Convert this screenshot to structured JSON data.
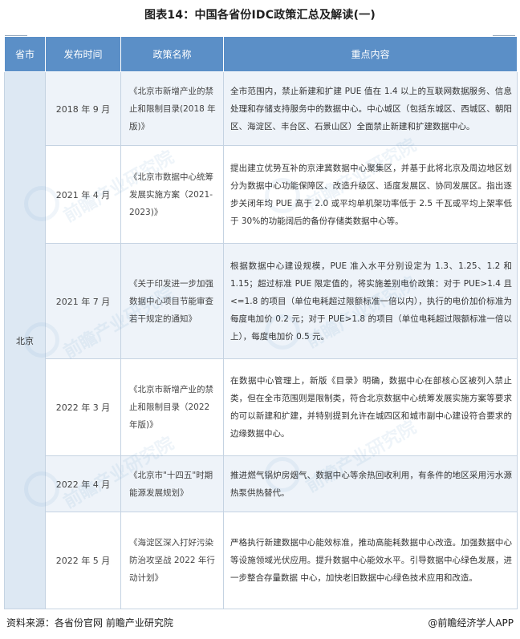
{
  "title": "图表14：中国各省份IDC政策汇总及解读(一)",
  "table": {
    "headers": [
      "省市",
      "发布时间",
      "政策名称",
      "重点内容"
    ],
    "province": "北京",
    "rows": [
      {
        "date": "2018 年 9 月",
        "name": "《北京市新增产业的禁止和限制目录(2018 年版)》",
        "content": "全市范围内，禁止新建和扩建 PUE 值在 1.4 以上的互联网数据服务、信息处理和存储支持服务中的数据中心。中心城区（包括东城区、西城区、朝阳区、海淀区、丰台区、石景山区）全面禁止新建和扩建数据中心。"
      },
      {
        "date": "2021 年 4 月",
        "name": "《北京市数据中心统筹发展实施方案（2021-2023)》",
        "content": "提出建立优势互补的京津冀数据中心聚集区，并基于此将北京及周边地区划分为数据中心功能保障区、改造升级区、适度发展区、协同发展区。指出逐步关闭年均 PUE 高于 2.0 或平均单机架功率低于 2.5 千瓦或平均上架率低于 30%的功能阔后的备份存储类数据中心等。"
      },
      {
        "date": "2021 年 7 月",
        "name": "《关于印发进一步加强数据中心项目节能审查若干规定的通知》",
        "content": "根据数据中心建设规模，PUE 准入水平分别设定为 1.3、1.25、1.2 和 1.15；超过标准 PUE 限定值的，将实施差别电价政策：对于 PUE>1.4 且<=1.8 的项目（单位电耗超过限额标准一倍以内），执行的电价加价标准为每度电加价 0.2 元；对于 PUE>1.8 的项目（单位电耗超过限额标准一倍以上），每度电加价 0.5 元。"
      },
      {
        "date": "2022 年 3 月",
        "name": "《北京市新增产业的禁止和限制目录（2022 年版)》",
        "content": "在数据中心管理上，新版《目录》明确，数据中心在部核心区被列入禁止类，但在全市范围则是限制类，符合北京数据中心统筹发展实施方案等要求的可以新建和扩建，并特别提到允许在城四区和城市副中心建设符合要求的边缘数据中心。"
      },
      {
        "date": "2022 年 4 月",
        "name": "《北京市\"十四五\"时期能源发展规划》",
        "content": "推进燃气锅炉房烟气、数据中心等余热回收利用，有条件的地区采用污水源热泵供热替代。"
      },
      {
        "date": "2022 年 5 月",
        "name": "《海淀区深入打好污染防治攻坚战 2022 年行动计划》",
        "content": "严格执行新建数据中心能效标准，推动高能耗数据中心改造。加强数据中心等设施领域光伏应用。提升数据中心能效水平。引导数据中心绿色发展，进一步整合存量数据 中心，加快老旧数据中心绿色技术应用和改造。"
      }
    ]
  },
  "watermark": "前瞻产业研究院",
  "footer": {
    "source": "资料来源：各省份官网 前瞻产业研究院",
    "brand": "@前瞻经济学人APP"
  },
  "colors": {
    "header_bg": "#5b8fc7",
    "province_bg": "#dde8f3",
    "alt_row_bg": "#eef3f9",
    "border": "#c5d3e2"
  }
}
